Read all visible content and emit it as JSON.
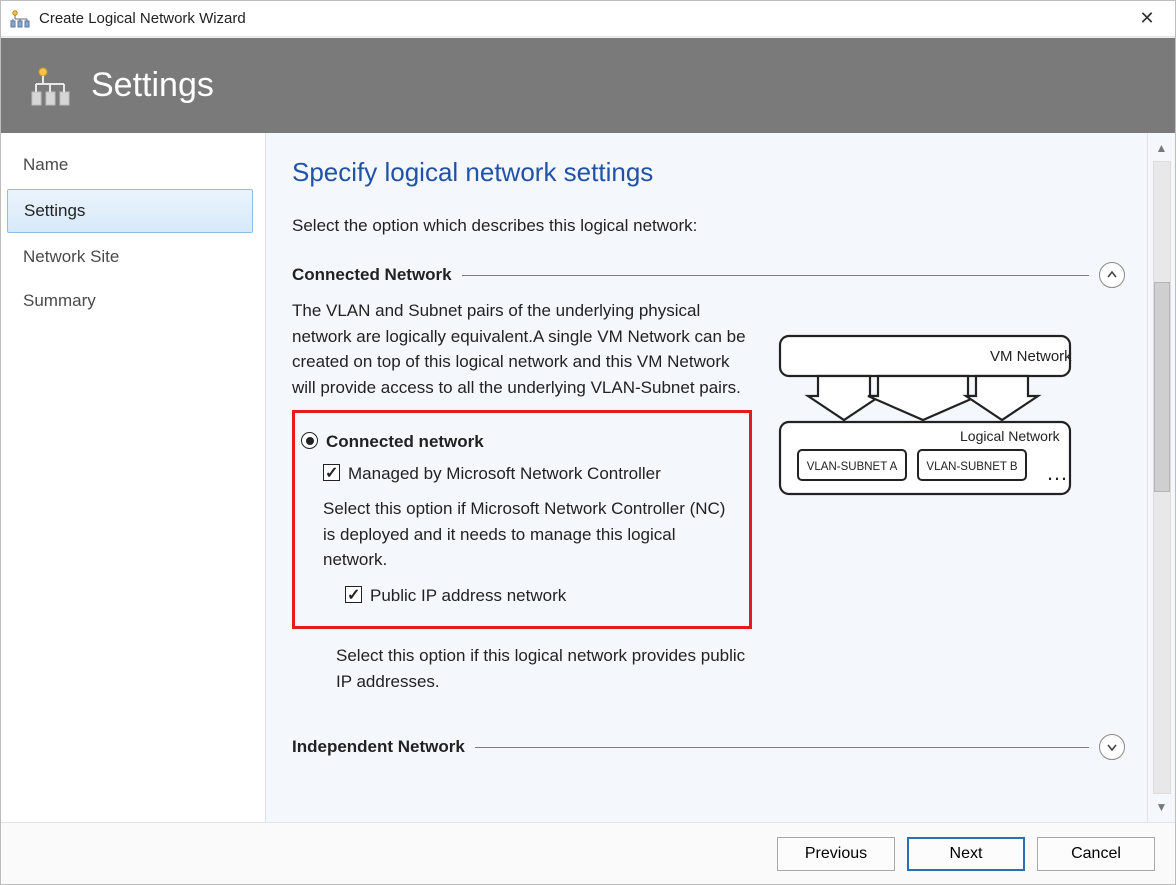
{
  "window": {
    "title": "Create Logical Network Wizard",
    "close_glyph": "✕"
  },
  "banner": {
    "title": "Settings"
  },
  "sidebar": {
    "items": [
      {
        "label": "Name",
        "selected": false
      },
      {
        "label": "Settings",
        "selected": true
      },
      {
        "label": "Network Site",
        "selected": false
      },
      {
        "label": "Summary",
        "selected": false
      }
    ]
  },
  "main": {
    "page_title": "Specify logical network settings",
    "instruction": "Select the option which describes this logical network:",
    "sections": {
      "connected": {
        "title": "Connected Network",
        "description": "The VLAN and Subnet pairs of the underlying physical network are logically equivalent.A single VM Network can be created on top of this logical network and this VM Network will provide access to all the underlying VLAN-Subnet pairs.",
        "radio_label": "Connected network",
        "radio_checked": true,
        "managed_label": "Managed by Microsoft Network Controller",
        "managed_checked": true,
        "managed_desc": "Select this option if Microsoft Network Controller (NC) is deployed and it needs to manage this logical network.",
        "publicip_label": "Public IP address network",
        "publicip_checked": true,
        "publicip_desc": "Select this option if this logical network provides public IP addresses."
      },
      "independent": {
        "title": "Independent Network"
      }
    },
    "diagram": {
      "vm_label": "VM Network",
      "logical_label": "Logical  Network",
      "vlan_a": "VLAN-SUBNET A",
      "vlan_b": "VLAN-SUBNET B",
      "ellipsis": "…"
    }
  },
  "footer": {
    "previous": "Previous",
    "next": "Next",
    "cancel": "Cancel"
  }
}
